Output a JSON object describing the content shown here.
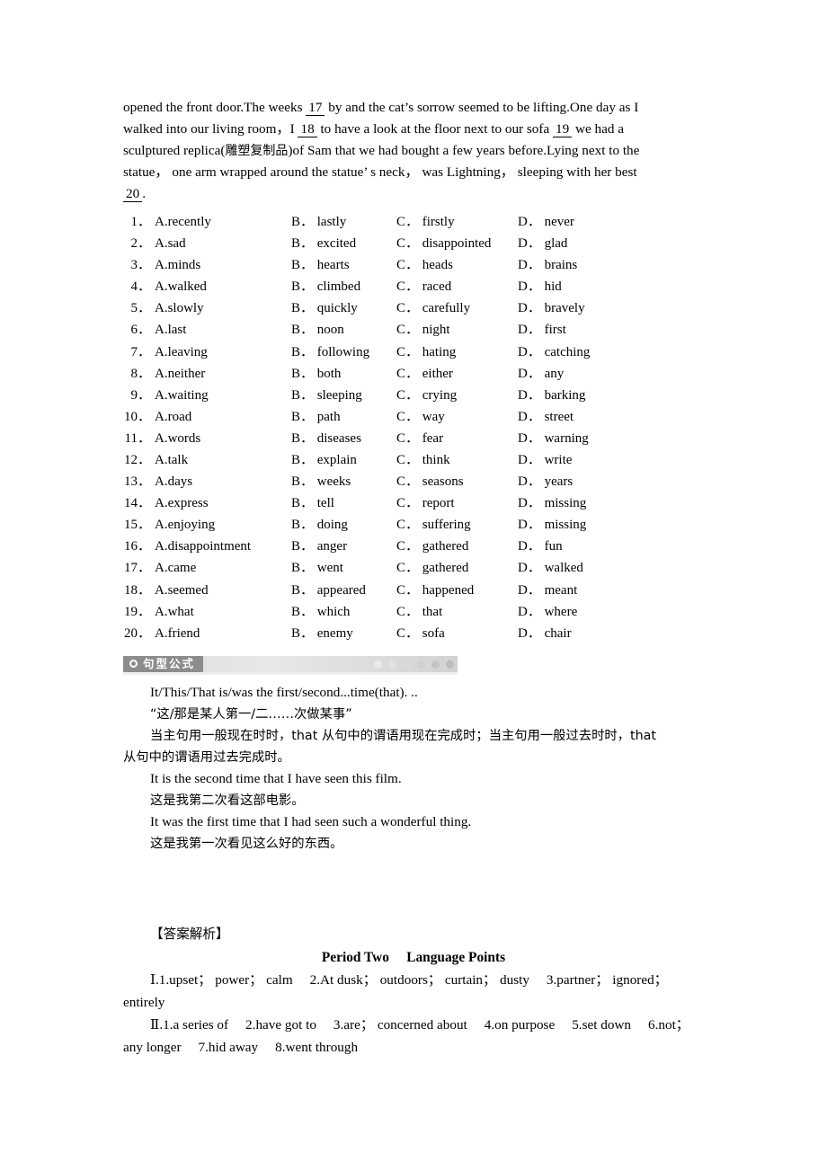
{
  "document": {
    "passage": {
      "lines": [
        [
          {
            "t": "text",
            "v": "opened the front door.The weeks "
          },
          {
            "t": "blank",
            "v": "17"
          },
          {
            "t": "text",
            "v": " by and the cat’s sorrow seemed to be lifting.One day as I"
          }
        ],
        [
          {
            "t": "text",
            "v": "walked into our living room，I "
          },
          {
            "t": "blank",
            "v": "18"
          },
          {
            "t": "text",
            "v": " to have a look at the floor next to our sofa "
          },
          {
            "t": "blank",
            "v": "19"
          },
          {
            "t": "text",
            "v": " we had a"
          }
        ],
        [
          {
            "t": "text",
            "v": "sculptured replica("
          },
          {
            "t": "cjk",
            "v": "雕塑复制品"
          },
          {
            "t": "text",
            "v": ")of Sam that we had bought a few years before.Lying next to the"
          }
        ],
        [
          {
            "t": "text",
            "v": "statue， one arm wrapped around the statue’ s neck， was Lightning， sleeping with her best"
          }
        ],
        [
          {
            "t": "blank",
            "v": "20"
          },
          {
            "t": "text",
            "v": "."
          }
        ]
      ]
    },
    "options": {
      "letters": [
        "A.",
        "B．",
        "C．",
        "D．"
      ],
      "rows": [
        {
          "num": "1．",
          "a": "recently",
          "b": "lastly",
          "c": "firstly",
          "d": "never"
        },
        {
          "num": "2．",
          "a": "sad",
          "b": "excited",
          "c": "disappointed",
          "d": "glad"
        },
        {
          "num": "3．",
          "a": "minds",
          "b": "hearts",
          "c": "heads",
          "d": "brains"
        },
        {
          "num": "4．",
          "a": "walked",
          "b": "climbed",
          "c": "raced",
          "d": "hid"
        },
        {
          "num": "5．",
          "a": "slowly",
          "b": "quickly",
          "c": "carefully",
          "d": "bravely"
        },
        {
          "num": "6．",
          "a": "last",
          "b": "noon",
          "c": "night",
          "d": "first"
        },
        {
          "num": "7．",
          "a": "leaving",
          "b": "following",
          "c": "hating",
          "d": "catching"
        },
        {
          "num": "8．",
          "a": "neither",
          "b": "both",
          "c": "either",
          "d": "any"
        },
        {
          "num": "9．",
          "a": "waiting",
          "b": "sleeping",
          "c": "crying",
          "d": "barking"
        },
        {
          "num": "10．",
          "a": "road",
          "b": "path",
          "c": "way",
          "d": "street"
        },
        {
          "num": "11．",
          "a": "words",
          "b": "diseases",
          "c": "fear",
          "d": "warning"
        },
        {
          "num": "12．",
          "a": "talk",
          "b": "explain",
          "c": "think",
          "d": "write"
        },
        {
          "num": "13．",
          "a": "days",
          "b": "weeks",
          "c": "seasons",
          "d": "years"
        },
        {
          "num": "14．",
          "a": "express",
          "b": "tell",
          "c": "report",
          "d": "missing"
        },
        {
          "num": "15．",
          "a": "enjoying",
          "b": "doing",
          "c": "suffering",
          "d": "missing"
        },
        {
          "num": "16．",
          "a": "disappointment",
          "b": "anger",
          "c": "gathered",
          "d": "fun"
        },
        {
          "num": "17．",
          "a": "came",
          "b": "went",
          "c": "gathered",
          "d": "walked"
        },
        {
          "num": "18．",
          "a": "seemed",
          "b": "appeared",
          "c": "happened",
          "d": "meant"
        },
        {
          "num": "19．",
          "a": "what",
          "b": "which",
          "c": "that",
          "d": "where"
        },
        {
          "num": "20．",
          "a": "friend",
          "b": "enemy",
          "c": "sofa",
          "d": "chair"
        }
      ]
    },
    "banner": {
      "title": "句型公式",
      "bullet_icon": "circle-bullet-icon",
      "dot_colors": [
        "#eaeaea",
        "#e2e2e2",
        "#dadada",
        "#d0d0d0",
        "#c4c4c4",
        "#bcbcbc"
      ],
      "tab_color": "#8c8c8c"
    },
    "formula": {
      "line1": "It/This/That is/was the first/second...time(that).  ..",
      "line2": "“这/那是某人第一/二……次做某事”",
      "line3a": "当主句用一般现在时时，that 从句中的谓语用现在完成时；当主句用一般过去时时，that",
      "line3b": "从句中的谓语用过去完成时。",
      "example1_en": "It is the second time that I have seen this film.",
      "example1_cn": "这是我第二次看这部电影。",
      "example2_en": "It was the first time that I had seen such a wonderful thing.",
      "example2_cn": "这是我第一次看见这么好的东西。"
    },
    "answers": {
      "heading": "【答案解析】",
      "period_title": "Period Two　 Language Points",
      "section1_line1": "Ⅰ.1.upset； power； calm　 2.At dusk； outdoors； curtain； dusty　 3.partner； ignored；",
      "section1_line2": "entirely",
      "section2_line1": "Ⅱ.1.a series of　 2.have got to　 3.are； concerned about　 4.on purpose　 5.set down　 6.not；",
      "section2_line2": "any longer　 7.hid away　 8.went through"
    }
  }
}
